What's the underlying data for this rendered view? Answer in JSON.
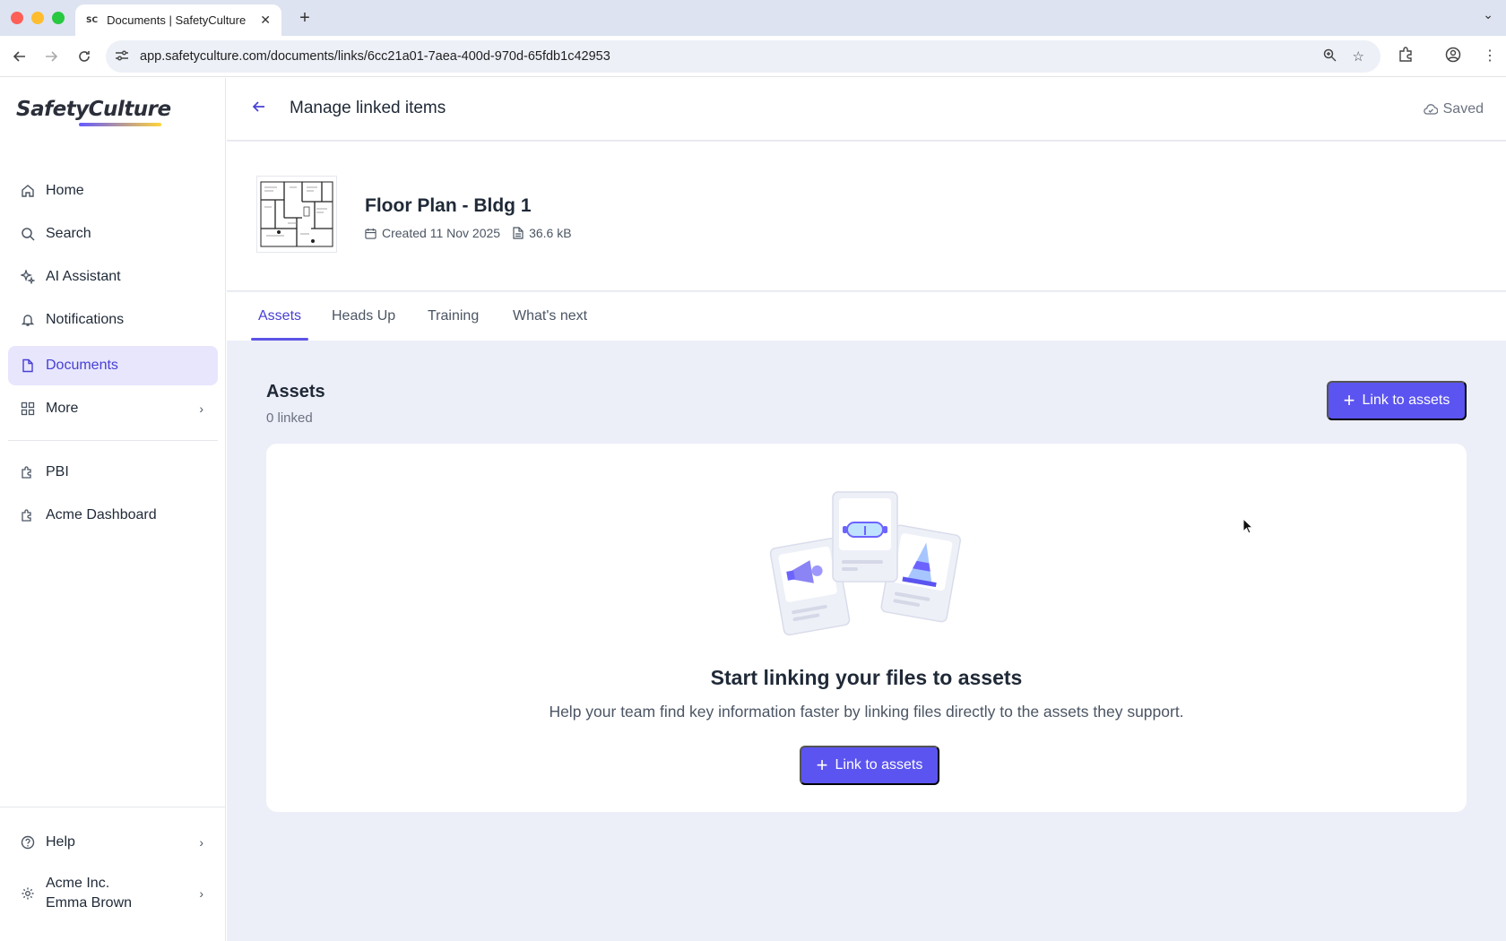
{
  "browser": {
    "tab_title": "Documents | SafetyCulture",
    "favicon_text": "SC",
    "url": "app.safetyculture.com/documents/links/6cc21a01-7aea-400d-970d-65fdb1c42953"
  },
  "sidebar": {
    "logo": "SafetyCulture",
    "items": [
      {
        "label": "Home",
        "icon": "home-icon"
      },
      {
        "label": "Search",
        "icon": "search-icon"
      },
      {
        "label": "AI Assistant",
        "icon": "sparkle-icon"
      },
      {
        "label": "Notifications",
        "icon": "bell-icon"
      },
      {
        "label": "Documents",
        "icon": "document-icon",
        "active": true
      },
      {
        "label": "More",
        "icon": "grid-icon"
      },
      {
        "label": "PBI",
        "icon": "puzzle-icon"
      },
      {
        "label": "Acme Dashboard",
        "icon": "puzzle-icon"
      },
      {
        "label": "Help",
        "icon": "help-icon"
      }
    ],
    "account": {
      "org": "Acme Inc.",
      "user": "Emma Brown"
    }
  },
  "header": {
    "title": "Manage linked items",
    "status": "Saved"
  },
  "document": {
    "name": "Floor Plan - Bldg 1",
    "created": "Created 11 Nov 2025",
    "size": "36.6 kB"
  },
  "tabs": [
    {
      "label": "Assets",
      "active": true
    },
    {
      "label": "Heads Up"
    },
    {
      "label": "Training"
    },
    {
      "label": "What's next"
    }
  ],
  "assets": {
    "title": "Assets",
    "count": "0 linked",
    "link_button": "Link to assets",
    "empty_title": "Start linking your files to assets",
    "empty_desc": "Help your team find key information faster by linking files directly to the assets they support.",
    "empty_button": "Link to assets"
  },
  "colors": {
    "accent": "#5b54f0",
    "active_nav_bg": "#e8e6fd",
    "main_bg": "#eceef8"
  }
}
